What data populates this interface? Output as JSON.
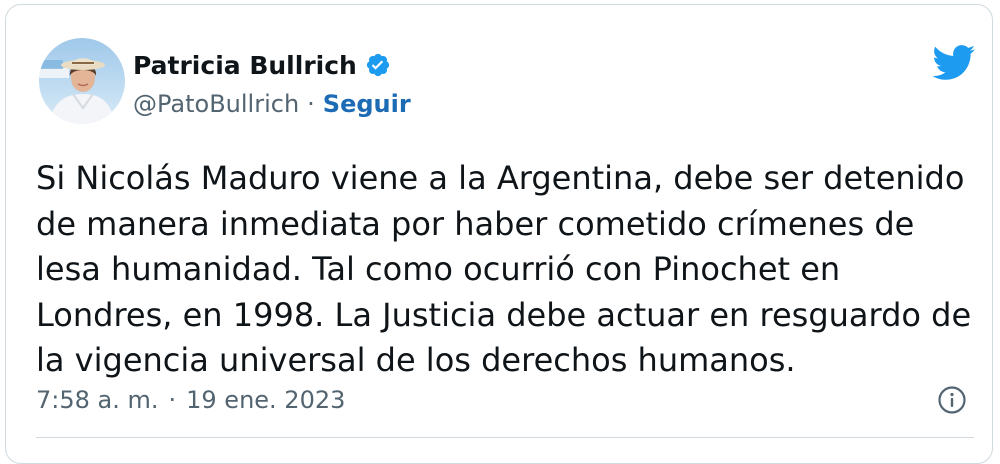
{
  "tweet": {
    "display_name": "Patricia Bullrich",
    "handle": "@PatoBullrich",
    "separator": "·",
    "follow_label": "Seguir",
    "text": "Si Nicolás Maduro viene a la Argentina, debe ser detenido\nde manera inmediata por haber cometido crímenes de\nlesa humanidad. Tal como ocurrió con Pinochet en\nLondres, en 1998. La Justicia debe actuar en resguardo de\nla vigencia universal de los derechos humanos.",
    "time": "7:58 a. m.",
    "date": "19 ene. 2023"
  },
  "icons": {
    "verified": "verified-badge-icon",
    "brand": "twitter-bird-icon",
    "info": "info-icon"
  },
  "colors": {
    "brand": "#1d9bf0",
    "follow": "#1d6bb5",
    "secondary_text": "#536471",
    "border": "#cfd9de"
  }
}
